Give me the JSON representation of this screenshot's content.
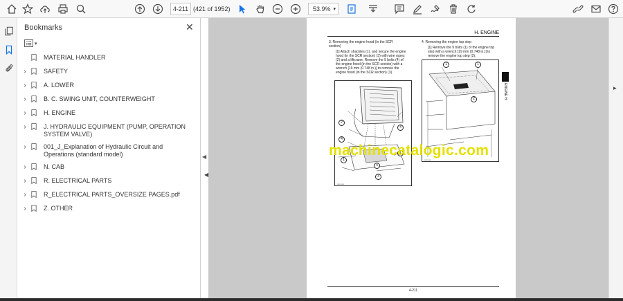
{
  "toolbar": {
    "page_input": "4-211",
    "page_count": "(421 of 1952)",
    "zoom": "53.9%",
    "icons": [
      "home-icon",
      "bookmark-star-icon",
      "upload-icon",
      "print-icon",
      "search-icon",
      "page-up-icon",
      "page-down-icon",
      "select-cursor-icon",
      "hand-icon",
      "zoom-out-icon",
      "zoom-in-icon",
      "zoom-dropdown-icon",
      "fit-page-icon",
      "scroll-mode-icon",
      "comment-icon",
      "pen-icon",
      "sign-icon",
      "delete-icon",
      "rotate-icon",
      "edit-link-icon",
      "mail-icon"
    ]
  },
  "leftrail": {
    "icons": [
      "pages-icon",
      "bookmarks-icon",
      "attachments-icon"
    ]
  },
  "panel": {
    "title": "Bookmarks",
    "items": [
      {
        "label": "MATERIAL HANDLER",
        "expandable": false
      },
      {
        "label": "SAFETY",
        "expandable": true
      },
      {
        "label": "A. LOWER",
        "expandable": true
      },
      {
        "label": "B. C. SWING UNIT, COUNTERWEIGHT",
        "expandable": true
      },
      {
        "label": "H. ENGINE",
        "expandable": true
      },
      {
        "label": "J. HYDRAULIC EQUIPMENT (PUMP, OPERATION SYSTEM VALVE)",
        "expandable": true
      },
      {
        "label": "001_J_Explanation of Hydraulic Circuit and Operations (standard model)",
        "expandable": true
      },
      {
        "label": "N. CAB",
        "expandable": true
      },
      {
        "label": "R. ELECTRICAL PARTS",
        "expandable": true
      },
      {
        "label": "R_ELECTRICAL PARTS_OVERSIZE PAGES.pdf",
        "expandable": true
      },
      {
        "label": "Z. OTHER",
        "expandable": true
      }
    ]
  },
  "document": {
    "section_header": "H. ENGINE",
    "step3_title": "3. Removing the engine hood (in the SCR section)",
    "step3_body": "[1] Attach shackles (1), and secure the engine hood (in the SCR section) (3) with wire ropes (2) and a liftcrane. Remove the 9 bolts (4) of the engine hood (in the SCR section) with a wrench [19 mm (0.748 in.)] to remove the engine hood (in the SCR section) (3).",
    "step4_title": "4. Removing the engine top step",
    "step4_body": "[1] Remove the 9 bolts (1) of the engine top step with a wrench [19 mm (0.748 in.)] to remove the engine top step (2).",
    "side_tab": "ENGINE H",
    "footer": "4-211",
    "watermark": "machinecatalogic.com"
  }
}
